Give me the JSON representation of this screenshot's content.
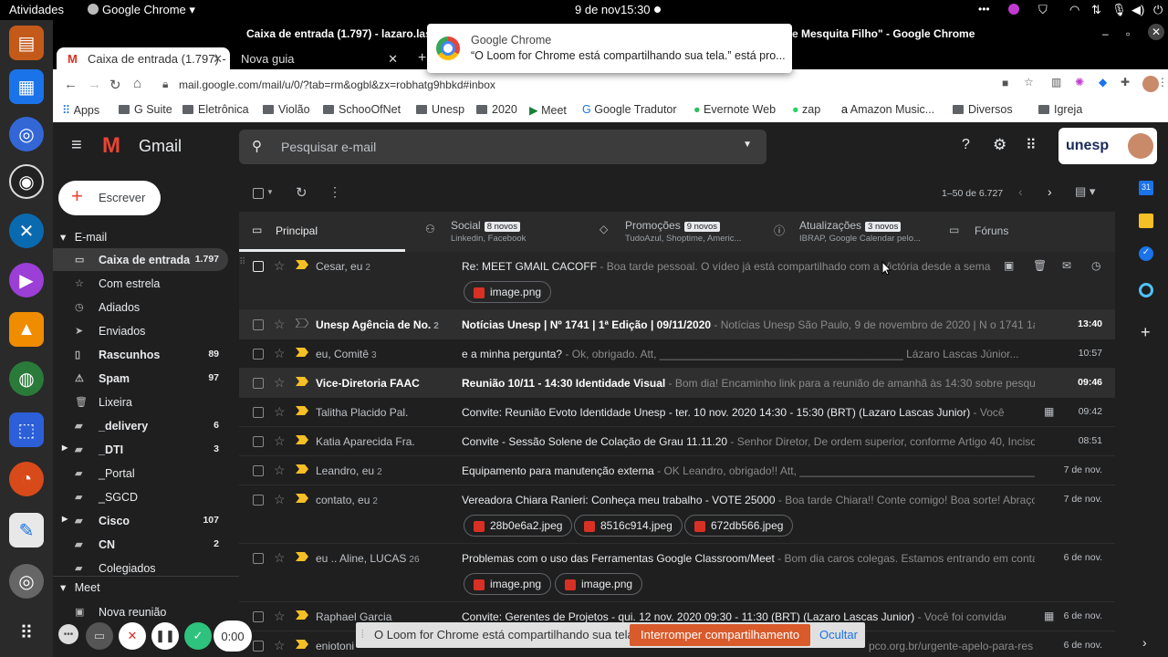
{
  "system": {
    "activities": "Atividades",
    "app_menu": "Google Chrome ▾",
    "date": "9 de nov",
    "time": "15:30"
  },
  "window": {
    "title_left": "Caixa de entrada (1.797) - lazaro.las",
    "title_right": "e Mesquita Filho\" - Google Chrome"
  },
  "tabs": [
    {
      "label": "Caixa de entrada (1.797) -"
    },
    {
      "label": "Nova guia"
    }
  ],
  "notification": {
    "title": "Google Chrome",
    "body": "“O Loom for Chrome está compartilhando sua tela.” está pro..."
  },
  "omnibox": {
    "url": "mail.google.com/mail/u/0/?tab=rm&ogbl&zx=robhatg9hbkd#inbox"
  },
  "bookmarks": [
    "Apps",
    "G Suite",
    "Eletrônica",
    "Violão",
    "SchooOfNet",
    "Unesp",
    "2020",
    "Meet",
    "Google Tradutor",
    "Evernote Web",
    "zap",
    "Amazon Music...",
    "Diversos",
    "Igreja"
  ],
  "gmail": {
    "logo": "Gmail",
    "search_placeholder": "Pesquisar e-mail",
    "org": "unesp",
    "compose": "Escrever",
    "email_section": "E-mail",
    "meet_section": "Meet",
    "new_meeting": "Nova reunião",
    "pagination": "1–50 de 6.727",
    "nav": [
      {
        "label": "Caixa de entrada",
        "count": "1.797"
      },
      {
        "label": "Com estrela",
        "count": ""
      },
      {
        "label": "Adiados",
        "count": ""
      },
      {
        "label": "Enviados",
        "count": ""
      },
      {
        "label": "Rascunhos",
        "count": "89"
      },
      {
        "label": "Spam",
        "count": "97"
      },
      {
        "label": "Lixeira",
        "count": ""
      },
      {
        "label": "_delivery",
        "count": "6"
      },
      {
        "label": "_DTI",
        "count": "3"
      },
      {
        "label": "_Portal",
        "count": ""
      },
      {
        "label": "_SGCD",
        "count": ""
      },
      {
        "label": "Cisco",
        "count": "107"
      },
      {
        "label": "CN",
        "count": "2"
      },
      {
        "label": "Colegiados",
        "count": ""
      }
    ],
    "categories": [
      {
        "label": "Principal",
        "badge": "",
        "sub": ""
      },
      {
        "label": "Social",
        "badge": "8 novos",
        "sub": "Linkedin, Facebook"
      },
      {
        "label": "Promoções",
        "badge": "9 novos",
        "sub": "TudoAzul, Shoptime, Americ..."
      },
      {
        "label": "Atualizações",
        "badge": "3 novos",
        "sub": "IBRAP, Google Calendar pelo..."
      },
      {
        "label": "Fóruns",
        "badge": "",
        "sub": ""
      }
    ],
    "emails": [
      {
        "sender": "Cesar, eu",
        "count": "2",
        "subject": "Re: MEET GMAIL CACOFF",
        "snippet": " - Boa tarde pessoal. O vídeo já está compartilhado com a Victória desde a semana p...",
        "date": "",
        "attachments": [
          "image.png"
        ]
      },
      {
        "sender": "Unesp Agência de No.",
        "count": "2",
        "subject": "Notícias Unesp | Nº 1741 | 1ª Edição | 09/11/2020",
        "snippet": " - Notícias Unesp São Paulo, 9 de novembro de 2020 | N o 1741 1a Edi...",
        "date": "13:40",
        "attachments": []
      },
      {
        "sender": "eu, Comitê",
        "count": "3",
        "subject": "e a minha pergunta?",
        "snippet": " - Ok, obrigado. Att, ________________________________________ Lázaro Lascas Júnior...",
        "date": "10:57",
        "attachments": []
      },
      {
        "sender": "Vice-Diretoria FAAC",
        "count": "",
        "subject": "Reunião 10/11 - 14:30 Identidade Visual",
        "snippet": " - Bom dia! Encaminho link para a reunião de amanhã às 14:30 sobre pesquisa d...",
        "date": "09:46",
        "attachments": []
      },
      {
        "sender": "Talitha Placido Pal.",
        "count": "",
        "subject": "Convite: Reunião Evoto Identidade Unesp - ter. 10 nov. 2020 14:30 - 15:30 (BRT) (Lazaro Lascas Junior)",
        "snippet": " - Você foi convid...",
        "date": "09:42",
        "attachments": []
      },
      {
        "sender": "Katia Aparecida Fra.",
        "count": "",
        "subject": "Convite - Sessão Solene de Colação de Grau 11.11.20",
        "snippet": " - Senhor Diretor, De ordem superior, conforme Artigo 40, Inciso XX...",
        "date": "08:51",
        "attachments": []
      },
      {
        "sender": "Leandro, eu",
        "count": "2",
        "subject": "Equipamento para manutenção externa",
        "snippet": " - OK Leandro, obrigado!! Att, ________________________________________...",
        "date": "7 de nov.",
        "attachments": []
      },
      {
        "sender": "contato, eu",
        "count": "2",
        "subject": "Vereadora Chiara Ranieri: Conheça meu trabalho - VOTE 25000",
        "snippet": " - Boa tarde Chiara!! Conte comigo! Boa sorte! Abraços Lá...",
        "date": "7 de nov.",
        "attachments": [
          "28b0e6a2.jpeg",
          "8516c914.jpeg",
          "672db566.jpeg"
        ]
      },
      {
        "sender": "eu .. Aline, LUCAS",
        "count": "26",
        "subject": "Problemas com o uso das Ferramentas Google Classroom/Meet",
        "snippet": " - Bom dia caros colegas. Estamos entrando em contato ...",
        "date": "6 de nov.",
        "attachments": [
          "image.png",
          "image.png"
        ]
      },
      {
        "sender": "Raphael Garcia",
        "count": "",
        "subject": "Convite: Gerentes de Projetos - qui. 12 nov. 2020 09:30 - 11:30 (BRT) (Lazaro Lascas Junior)",
        "snippet": " - Você foi convidado para o ...",
        "date": "6 de nov.",
        "attachments": []
      },
      {
        "sender": "eniotoni",
        "count": "",
        "subject": "",
        "snippet": "pco.org.br/urgente-apelo-para-resi...",
        "date": "6 de nov.",
        "attachments": []
      }
    ]
  },
  "loom": {
    "message": "O Loom for Chrome está compartilhando sua tela.",
    "stop": "Interromper compartilhamento",
    "hide": "Ocultar",
    "timer": "0:00"
  }
}
